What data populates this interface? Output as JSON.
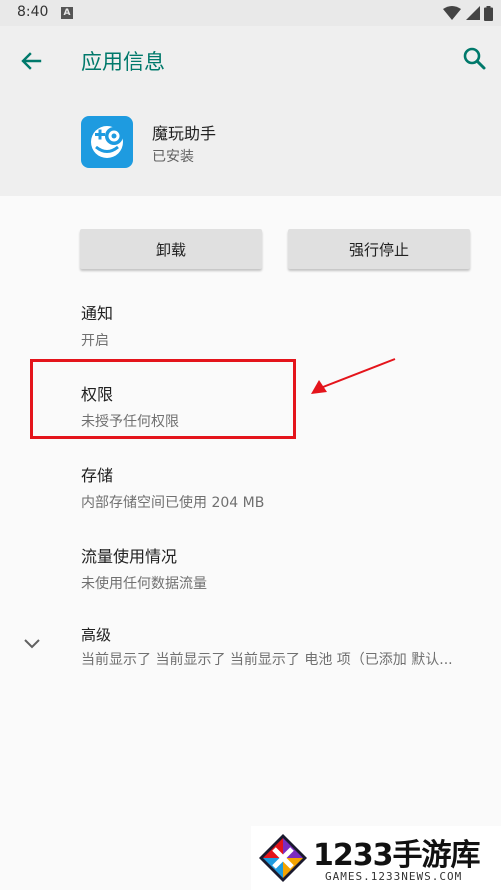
{
  "status_bar": {
    "time": "8:40",
    "notification_icon": "A"
  },
  "header": {
    "title": "应用信息"
  },
  "app": {
    "name": "魔玩助手",
    "status": "已安装"
  },
  "buttons": {
    "uninstall": "卸载",
    "force_stop": "强行停止"
  },
  "settings": [
    {
      "title": "通知",
      "subtitle": "开启"
    },
    {
      "title": "权限",
      "subtitle": "未授予任何权限"
    },
    {
      "title": "存储",
      "subtitle": "内部存储空间已使用 204 MB"
    },
    {
      "title": "流量使用情况",
      "subtitle": "未使用任何数据流量"
    },
    {
      "title": "高级",
      "subtitle": "当前显示了 当前显示了 当前显示了 电池 项（已添加 默认..."
    }
  ],
  "watermark": {
    "title": "1233手游库",
    "subtitle": "GAMES.1233NEWS.COM"
  },
  "colors": {
    "accent": "#00796b",
    "highlight": "#e4141b",
    "app_icon": "#1e9be0"
  }
}
